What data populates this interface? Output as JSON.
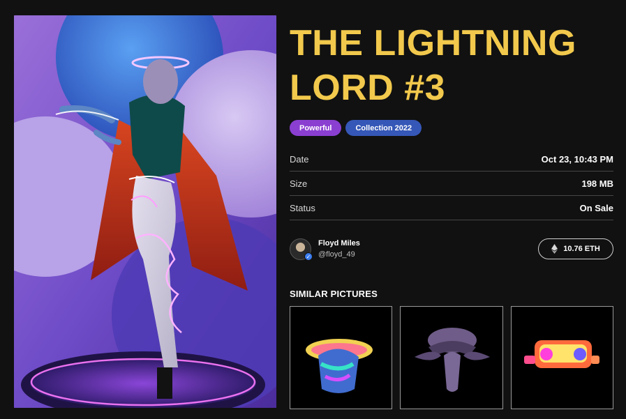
{
  "item": {
    "title_line1": "THE LIGHTNING",
    "title_line2": "LORD #3",
    "tags": [
      "Powerful",
      "Collection 2022"
    ]
  },
  "meta": [
    {
      "label": "Date",
      "value": "Oct 23, 10:43 PM"
    },
    {
      "label": "Size",
      "value": "198 MB"
    },
    {
      "label": "Status",
      "value": "On Sale"
    }
  ],
  "owner": {
    "name": "Floyd Miles",
    "handle": "@floyd_49"
  },
  "price": {
    "label": "10.76 ETH",
    "icon": "ethereum-icon"
  },
  "similar": {
    "title": "SIMILAR PICTURES",
    "items": [
      "holographic-vr-head",
      "chrome-mushroom",
      "neon-vr-goggles"
    ]
  },
  "colors": {
    "title": "#f2c94c",
    "tag_purple": "#8a3fd1",
    "tag_blue": "#3557b7",
    "background": "#111111"
  }
}
